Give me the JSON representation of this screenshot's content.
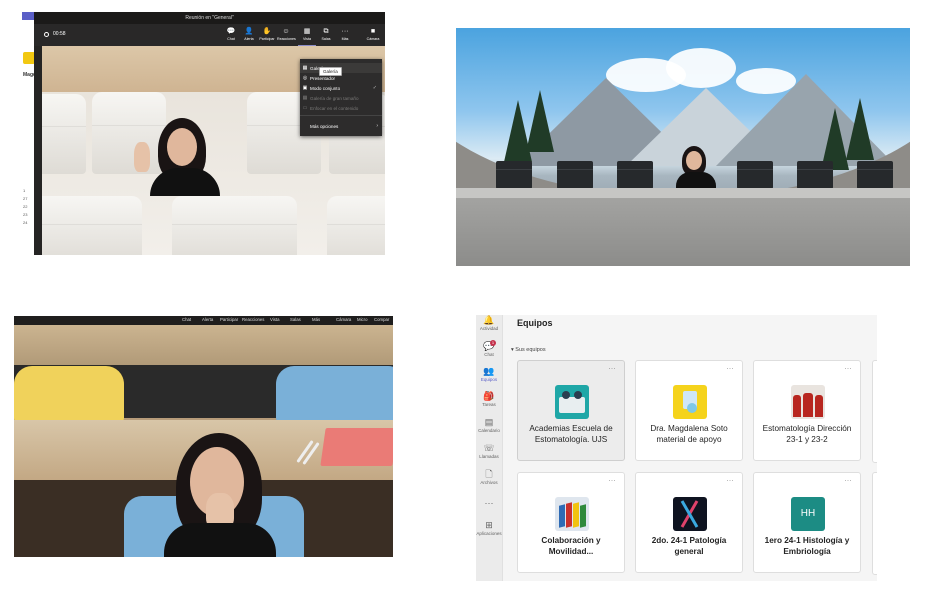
{
  "meeting": {
    "window_title": "Reunión en \"General\"",
    "timer": "00:58",
    "toolbar": [
      {
        "icon": "chat-icon",
        "glyph": "💬",
        "label": "Chat"
      },
      {
        "icon": "hand-icon",
        "glyph": "👤",
        "label": "Alerta"
      },
      {
        "icon": "participants-icon",
        "glyph": "✋",
        "label": "Participar"
      },
      {
        "icon": "reactions-icon",
        "glyph": "☺",
        "label": "Reacciones"
      },
      {
        "icon": "view-icon",
        "glyph": "▦",
        "label": "Vista"
      },
      {
        "icon": "rooms-icon",
        "glyph": "⧉",
        "label": "Salas"
      },
      {
        "icon": "more-icon",
        "glyph": "···",
        "label": "Más"
      },
      {
        "icon": "camera-icon",
        "glyph": "■",
        "label": "Cámara"
      }
    ],
    "view_menu": {
      "items": [
        {
          "label": "Galería",
          "glyph": "▦",
          "disabled": false
        },
        {
          "label": "Presentador",
          "glyph": "◎",
          "disabled": false
        },
        {
          "label": "Modo conjunto",
          "glyph": "▣",
          "disabled": false,
          "checked": true
        },
        {
          "label": "Galería de gran tamaño",
          "glyph": "▦",
          "disabled": true
        },
        {
          "label": "Enfocar en el contenido",
          "glyph": "▭",
          "disabled": true
        },
        {
          "label": "Más opciones",
          "glyph": "",
          "disabled": false,
          "submenu": true
        }
      ],
      "tooltip": "Galería"
    },
    "left_strip": {
      "heading": "Magda",
      "numbers": [
        "1",
        "27",
        "22",
        "23",
        "24"
      ]
    }
  },
  "classroom_toolbar": [
    "Chat",
    "Alerta",
    "Participar",
    "Reacciones",
    "Vista",
    "Salas",
    "Más",
    "Cámara",
    "Micro",
    "Compar"
  ],
  "teams": {
    "title": "Equipos",
    "section_label": "Sus equipos",
    "rail": [
      {
        "label": "Actividad",
        "glyph": "🔔"
      },
      {
        "label": "Chat",
        "glyph": "💬",
        "badge": "1"
      },
      {
        "label": "Equipos",
        "glyph": "👥",
        "active": true
      },
      {
        "label": "Tareas",
        "glyph": "🎒"
      },
      {
        "label": "Calendario",
        "glyph": "▤"
      },
      {
        "label": "Llamadas",
        "glyph": "☏"
      },
      {
        "label": "Archivos",
        "glyph": "🗋"
      },
      {
        "label": "",
        "glyph": "···"
      },
      {
        "label": "Aplicaciones",
        "glyph": "⊞"
      }
    ],
    "cards": [
      {
        "name": "Academias Escuela de Estomatología. UJS",
        "bold": false,
        "thumb_color": "#1fa7a7"
      },
      {
        "name": "Dra. Magdalena Soto material de apoyo",
        "bold": false,
        "thumb_color": "#f5d31c"
      },
      {
        "name": "Estomatología Dirección 23-1 y 23-2",
        "bold": false,
        "thumb_color": "#b8261f"
      },
      {
        "name": "Colaboración y Movilidad...",
        "bold": true,
        "thumb_color": "#dfe6ee"
      },
      {
        "name": "2do. 24-1 Patología general",
        "bold": true,
        "thumb_color": "#0e1320"
      },
      {
        "name": "1ero 24-1 Histología y Embriología",
        "bold": true,
        "thumb_color": "#1c8c84",
        "initials": "HH"
      }
    ],
    "more_glyph": "···"
  }
}
